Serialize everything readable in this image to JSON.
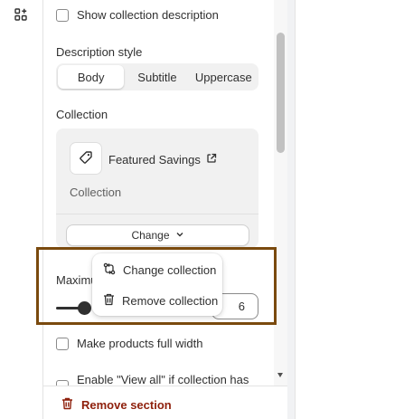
{
  "left_rail": {
    "icon": "sections-add-icon"
  },
  "settings": {
    "show_collection_description": "Show collection description",
    "description_style": {
      "label": "Description style",
      "options": [
        "Body",
        "Subtitle",
        "Uppercase"
      ],
      "selected": "Body"
    },
    "collection": {
      "label": "Collection",
      "name": "Featured Savings",
      "sub": "Collection",
      "change_label": "Change"
    },
    "maximum_label_partial": "Maximu",
    "max_value_partial": "6",
    "make_full_width": "Make products full width",
    "enable_view_all": "Enable \"View all\" if collection has"
  },
  "popover": {
    "change_collection": "Change collection",
    "remove_collection": "Remove collection"
  },
  "footer": {
    "remove_section": "Remove section"
  },
  "colors": {
    "destructive": "#8e1f0b",
    "highlight_border": "#7a4a0e"
  }
}
